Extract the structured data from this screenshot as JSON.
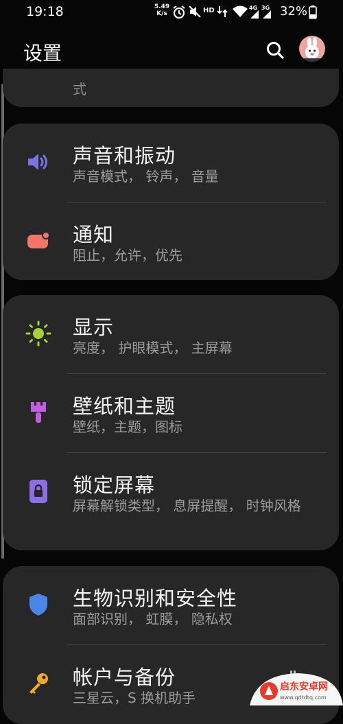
{
  "status_bar": {
    "time": "19:18",
    "net_speed_value": "5.49",
    "net_speed_unit": "K/s",
    "hd_label": "HD",
    "signal_4g": "4G",
    "signal_3g": "3G",
    "battery": "32%"
  },
  "header": {
    "title": "设置"
  },
  "partial_item": {
    "text": "式"
  },
  "sections": [
    {
      "items": [
        {
          "title": "声音和振动",
          "subtitle": "声音模式， 铃声， 音量",
          "icon": "speaker-icon",
          "icon_color": "#7c73e6"
        },
        {
          "title": "通知",
          "subtitle": "阻止，允许，优先",
          "icon": "notification-icon",
          "icon_color": "#f2776a"
        }
      ]
    },
    {
      "items": [
        {
          "title": "显示",
          "subtitle": "亮度， 护眼模式， 主屏幕",
          "icon": "brightness-icon",
          "icon_color": "#a5d13b"
        },
        {
          "title": "壁纸和主题",
          "subtitle": "壁纸，主题，图标",
          "icon": "paintbrush-icon",
          "icon_color": "#c35ee0"
        },
        {
          "title": "锁定屏幕",
          "subtitle": "屏幕解锁类型， 息屏提醒， 时钟风格",
          "icon": "lock-icon",
          "icon_color": "#8b6ee8"
        }
      ]
    },
    {
      "items": [
        {
          "title": "生物识别和安全性",
          "subtitle": "面部识别， 虹膜， 隐私权",
          "icon": "shield-icon",
          "icon_color": "#4a86e8"
        },
        {
          "title": "帐户与备份",
          "subtitle": "三星云，S 换机助手",
          "icon": "key-icon",
          "icon_color": "#f0a92c"
        }
      ]
    }
  ],
  "watermark": {
    "name": "启东安卓网",
    "url": "www.qdtdtq.com"
  }
}
